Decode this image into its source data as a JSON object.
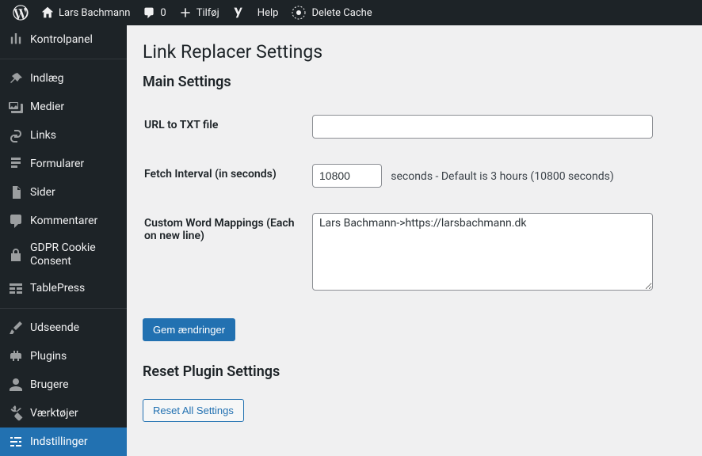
{
  "adminbar": {
    "site_name": "Lars Bachmann",
    "comments_count": "0",
    "add_new": "Tilføj",
    "help": "Help",
    "delete_cache": "Delete Cache"
  },
  "sidebar": {
    "items": [
      {
        "key": "dashboard",
        "label": "Kontrolpanel"
      },
      {
        "key": "posts",
        "label": "Indlæg"
      },
      {
        "key": "media",
        "label": "Medier"
      },
      {
        "key": "links",
        "label": "Links"
      },
      {
        "key": "forms",
        "label": "Formularer"
      },
      {
        "key": "pages",
        "label": "Sider"
      },
      {
        "key": "comments",
        "label": "Kommentarer"
      },
      {
        "key": "gdpr",
        "label": "GDPR Cookie Consent"
      },
      {
        "key": "tablepress",
        "label": "TablePress"
      },
      {
        "key": "appearance",
        "label": "Udseende"
      },
      {
        "key": "plugins",
        "label": "Plugins"
      },
      {
        "key": "users",
        "label": "Brugere"
      },
      {
        "key": "tools",
        "label": "Værktøjer"
      },
      {
        "key": "settings",
        "label": "Indstillinger"
      }
    ]
  },
  "page": {
    "title": "Link Replacer Settings",
    "main_heading": "Main Settings",
    "url_label": "URL to TXT file",
    "url_value": "",
    "interval_label": "Fetch Interval (in seconds)",
    "interval_value": "10800",
    "interval_desc": "seconds - Default is 3 hours (10800 seconds)",
    "mappings_label": "Custom Word Mappings (Each on new line)",
    "mappings_value": "Lars Bachmann->https://larsbachmann.dk",
    "save_button": "Gem ændringer",
    "reset_heading": "Reset Plugin Settings",
    "reset_button": "Reset All Settings"
  }
}
